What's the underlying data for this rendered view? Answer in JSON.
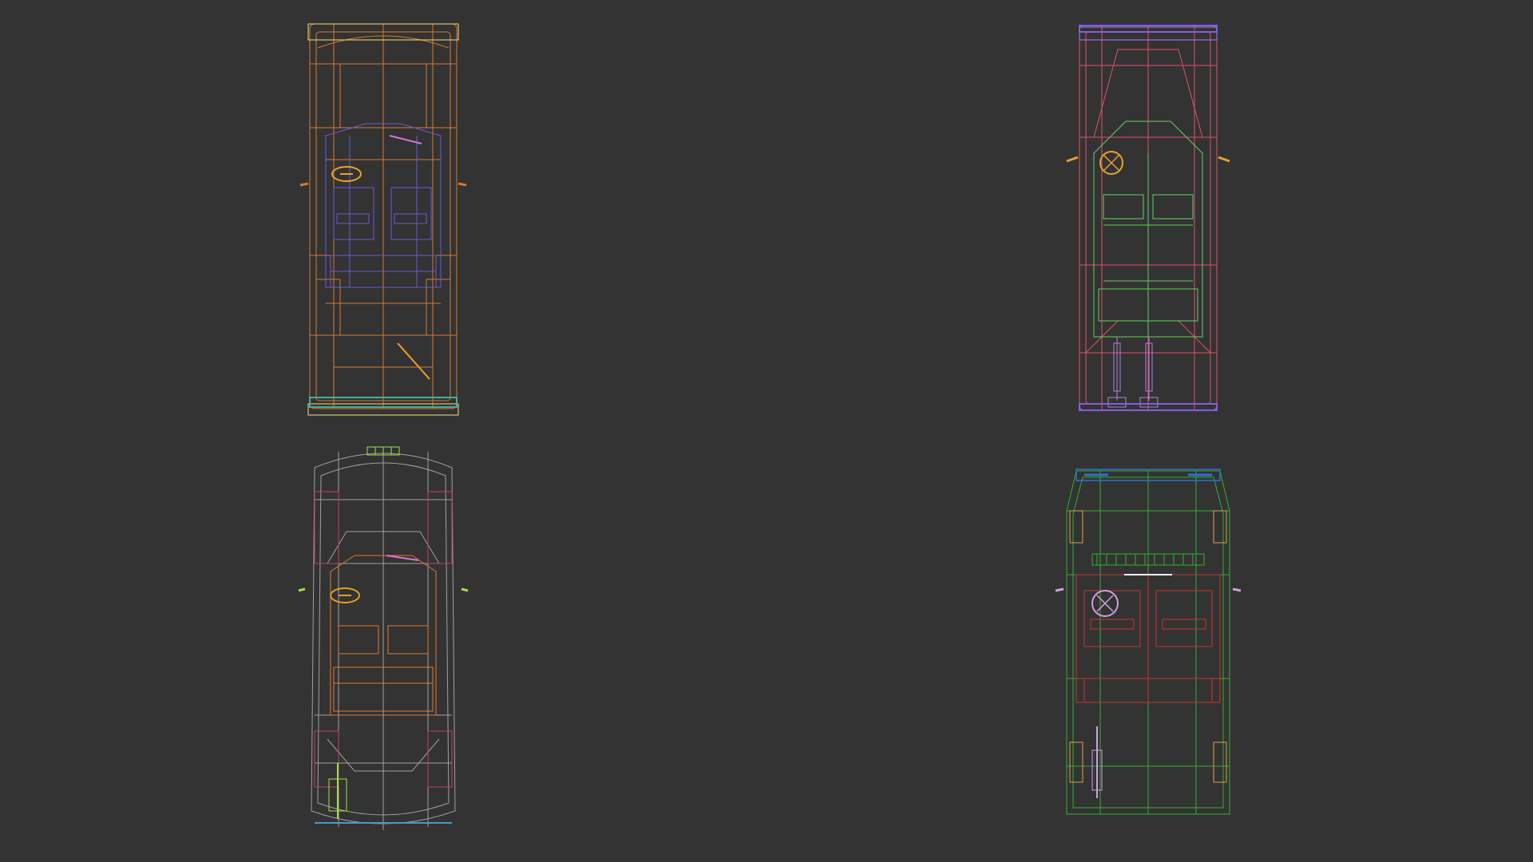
{
  "viewport": {
    "background": "#333333"
  },
  "cars": [
    {
      "id": "car-1",
      "name": "car-wireframe-top-view",
      "colors": {
        "body": "#d8782c",
        "interior": "#6a5ad8",
        "accent": "#f4e07a",
        "trim": "#f0a020",
        "bumper": "#40b0a0"
      }
    },
    {
      "id": "car-2",
      "name": "car-wireframe-top-view",
      "colors": {
        "body": "#e0506a",
        "interior": "#60d060",
        "accent": "#b080e0",
        "trim": "#e8a030",
        "bumper": "#8060e0"
      }
    },
    {
      "id": "car-3",
      "name": "car-wireframe-top-view",
      "colors": {
        "body": "#a0a0a0",
        "interior": "#e07a30",
        "accent": "#a0e040",
        "trim": "#e0a020",
        "bumper": "#40a0c0"
      }
    },
    {
      "id": "car-4",
      "name": "van-wireframe-top-view",
      "colors": {
        "body": "#30b030",
        "interior": "#d03030",
        "accent": "#d0a0e0",
        "trim": "#e0a040",
        "bumper": "#3070d0"
      }
    }
  ]
}
